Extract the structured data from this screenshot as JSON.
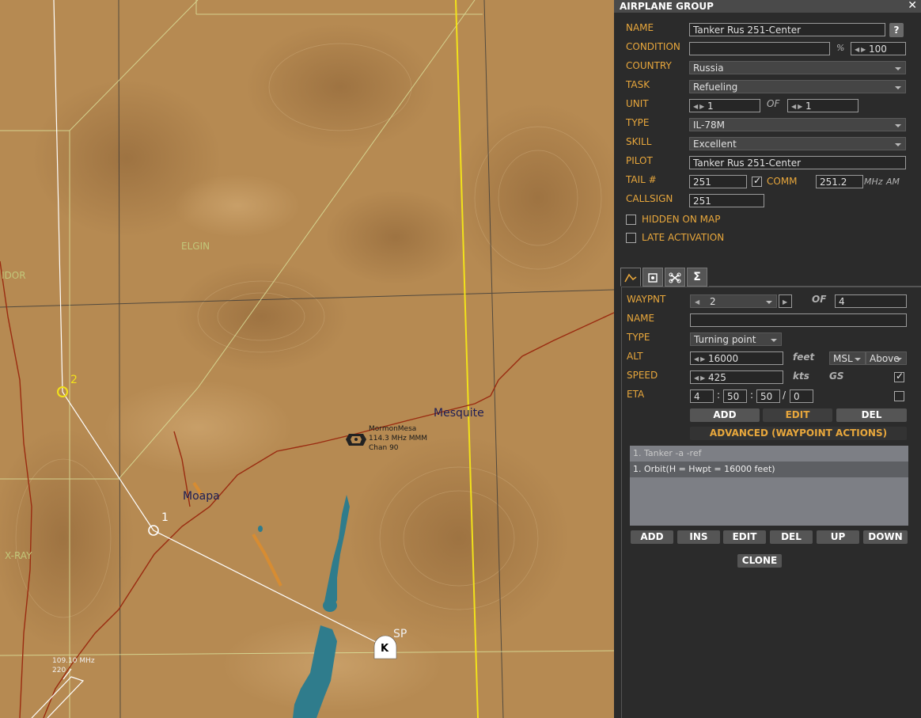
{
  "map": {
    "towns": {
      "mesquite": "Mesquite",
      "moapa": "Moapa"
    },
    "zones": {
      "elgin": "ELGIN",
      "xray": "X-RAY",
      "idor": "IDOR"
    },
    "navaid": {
      "name": "MormonMesa",
      "freq": "114.3 MHz MMM",
      "chan": "Chan 90"
    },
    "tacan": {
      "freq": "109.10 MHz",
      "code": "220"
    },
    "waypoints": {
      "w1": "1",
      "w2": "2",
      "sp": "SP",
      "k": "K"
    }
  },
  "panel": {
    "title": "AIRPLANE GROUP",
    "close": "✕",
    "labels": {
      "name": "NAME",
      "condition": "CONDITION",
      "country": "COUNTRY",
      "task": "TASK",
      "unit": "UNIT",
      "of": "OF",
      "type": "TYPE",
      "skill": "SKILL",
      "pilot": "PILOT",
      "tail": "TAIL #",
      "comm": "COMM",
      "mhz": "MHz",
      "am": "AM",
      "callsign": "CALLSIGN",
      "hidden": "HIDDEN ON MAP",
      "late": "LATE ACTIVATION",
      "percent": "%"
    },
    "values": {
      "name": "Tanker Rus 251-Center",
      "condition": "",
      "condition_pct": "100",
      "country": "Russia",
      "task": "Refueling",
      "unit": "1",
      "unit_of": "1",
      "type": "IL-78M",
      "skill": "Excellent",
      "pilot": "Tanker Rus 251-Center",
      "tail": "251",
      "comm": "251.2",
      "callsign": "251"
    },
    "help_btn": "?",
    "tabs": [
      "route-icon",
      "targets-icon",
      "payload-icon",
      "summary-icon"
    ],
    "waypoint": {
      "labels": {
        "waypnt": "WAYPNT",
        "of": "OF",
        "name": "NAME",
        "type": "TYPE",
        "alt": "ALT",
        "feet": "feet",
        "speed": "SPEED",
        "kts": "kts",
        "gs": "GS",
        "eta": "ETA"
      },
      "values": {
        "waypnt": "2",
        "of": "4",
        "name": "",
        "type": "Turning point",
        "alt": "16000",
        "alt_ref": "MSL",
        "alt_mode": "Above",
        "speed": "425",
        "eta_d": "4",
        "eta_h": "50",
        "eta_m": "50",
        "eta_s": "0"
      },
      "buttons": {
        "add": "ADD",
        "edit": "EDIT",
        "del": "DEL",
        "advanced": "ADVANCED (WAYPOINT ACTIONS)"
      },
      "actions": {
        "header": "1. Tanker -a -ref",
        "item": "1. Orbit(H = Hwpt = 16000 feet)"
      },
      "action_buttons": [
        "ADD",
        "INS",
        "EDIT",
        "DEL",
        "UP",
        "DOWN"
      ],
      "clone": "CLONE"
    }
  },
  "colors": {
    "accent": "#e8a73c",
    "panel_bg": "#2b2b2b",
    "terrain": "#b68a52",
    "water": "#2f7c8c",
    "road": "#9a2b10",
    "border_yellow": "#f2e21a",
    "waypoint": "#f2e21a"
  }
}
